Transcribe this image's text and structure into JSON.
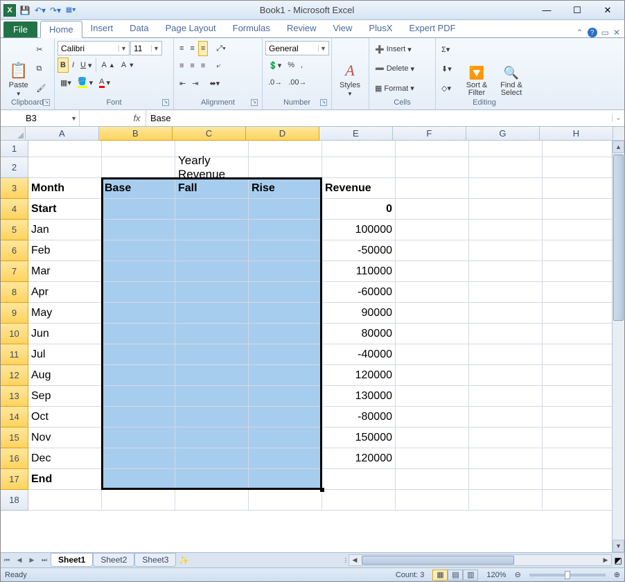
{
  "window": {
    "title": "Book1 - Microsoft Excel"
  },
  "qat": {
    "save": "💾",
    "undo": "↶",
    "redo": "↷"
  },
  "tabs": {
    "file": "File",
    "items": [
      "Home",
      "Insert",
      "Data",
      "Page Layout",
      "Formulas",
      "Review",
      "View",
      "PlusX",
      "Expert PDF"
    ],
    "active": "Home"
  },
  "ribbon": {
    "clipboard": {
      "label": "Clipboard",
      "paste": "Paste"
    },
    "font": {
      "label": "Font",
      "name": "Calibri",
      "size": "11"
    },
    "alignment": {
      "label": "Alignment"
    },
    "number": {
      "label": "Number",
      "format": "General"
    },
    "styles": {
      "label": "",
      "styles_btn": "Styles"
    },
    "cells": {
      "label": "Cells",
      "insert": "Insert",
      "delete": "Delete",
      "format": "Format"
    },
    "editing": {
      "label": "Editing",
      "sort": "Sort & Filter",
      "find": "Find & Select"
    }
  },
  "namebox": "B3",
  "formula": "Base",
  "columns": [
    "A",
    "B",
    "C",
    "D",
    "E",
    "F",
    "G",
    "H"
  ],
  "selected_cols": [
    "B",
    "C",
    "D"
  ],
  "row_numbers": [
    1,
    2,
    3,
    4,
    5,
    6,
    7,
    8,
    9,
    10,
    11,
    12,
    13,
    14,
    15,
    16,
    17,
    18
  ],
  "title_cell": "Yearly Revenue",
  "headers": {
    "A": "Month",
    "B": "Base",
    "C": "Fall",
    "D": "Rise",
    "E": "Revenue"
  },
  "rows": [
    {
      "month": "Start",
      "rev": "0",
      "bold": true
    },
    {
      "month": "Jan",
      "rev": "100000"
    },
    {
      "month": "Feb",
      "rev": "-50000"
    },
    {
      "month": "Mar",
      "rev": "110000"
    },
    {
      "month": "Apr",
      "rev": "-60000"
    },
    {
      "month": "May",
      "rev": "90000"
    },
    {
      "month": "Jun",
      "rev": "80000"
    },
    {
      "month": "Jul",
      "rev": "-40000"
    },
    {
      "month": "Aug",
      "rev": "120000"
    },
    {
      "month": "Sep",
      "rev": "130000"
    },
    {
      "month": "Oct",
      "rev": "-80000"
    },
    {
      "month": "Nov",
      "rev": "150000"
    },
    {
      "month": "Dec",
      "rev": "120000"
    },
    {
      "month": "End",
      "rev": "",
      "bold": true
    }
  ],
  "sheets": {
    "items": [
      "Sheet1",
      "Sheet2",
      "Sheet3"
    ],
    "active": "Sheet1"
  },
  "status": {
    "mode": "Ready",
    "count": "Count: 3",
    "zoom": "120%"
  }
}
